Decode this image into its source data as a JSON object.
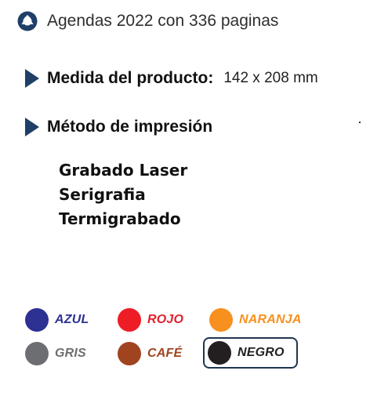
{
  "product": {
    "title": "Agendas 2022 con 336 paginas"
  },
  "specs": {
    "measure_label": "Medida del producto:",
    "measure_value": "142 x 208 mm",
    "method_label": "Método de impresión"
  },
  "print_methods": [
    "Grabado Laser",
    "Serigrafia",
    "Termigrabado"
  ],
  "colors": [
    {
      "name": "AZUL",
      "hex": "#2d3192",
      "label_color": "#2d3192",
      "selected": false
    },
    {
      "name": "ROJO",
      "hex": "#ee1c25",
      "label_color": "#e3202b",
      "selected": false
    },
    {
      "name": "NARANJA",
      "hex": "#f7901e",
      "label_color": "#f7901e",
      "selected": false
    },
    {
      "name": "GRIS",
      "hex": "#6d6e71",
      "label_color": "#6d6e71",
      "selected": false
    },
    {
      "name": "CAFÉ",
      "hex": "#a0441f",
      "label_color": "#a0441f",
      "selected": false
    },
    {
      "name": "NEGRO",
      "hex": "#231f20",
      "label_color": "#231f20",
      "selected": true
    }
  ],
  "theme": {
    "accent": "#1f3f68"
  }
}
